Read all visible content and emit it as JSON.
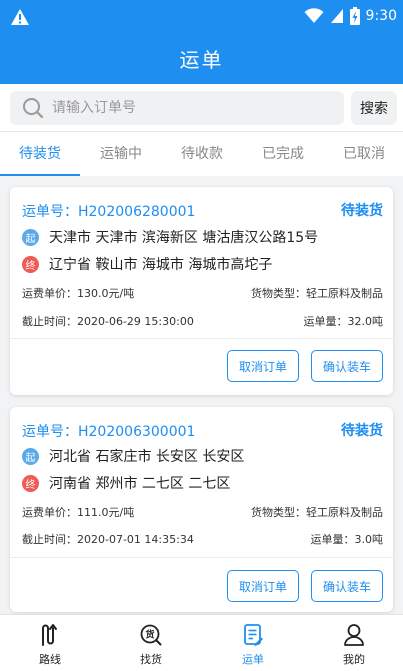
{
  "status_bar": {
    "time": "9:30"
  },
  "header": {
    "title": "运单"
  },
  "search": {
    "placeholder": "请输入订单号",
    "value": "",
    "button_label": "搜索"
  },
  "tabs": [
    {
      "label": "待装货",
      "active": true
    },
    {
      "label": "运输中"
    },
    {
      "label": "待收款"
    },
    {
      "label": "已完成"
    },
    {
      "label": "已取消"
    }
  ],
  "orders": [
    {
      "order_no": "运单号：H202006280001",
      "status": "待装货",
      "start_badge": "起",
      "from": "天津市 天津市 滨海新区 塘沽唐汉公路15号",
      "end_badge": "终",
      "to": "辽宁省 鞍山市 海城市 海城市高坨子",
      "unit_price": "运费单价：130.0元/吨",
      "cargo_type": "货物类型：轻工原料及制品",
      "deadline": "截止时间：2020-06-29 15:30:00",
      "volume": "运单量：32.0吨",
      "cancel_label": "取消订单",
      "confirm_label": "确认装车"
    },
    {
      "order_no": "运单号：H202006300001",
      "status": "待装货",
      "start_badge": "起",
      "from": "河北省 石家庄市 长安区 长安区",
      "end_badge": "终",
      "to": "河南省 郑州市 二七区 二七区",
      "unit_price": "运费单价：111.0元/吨",
      "cargo_type": "货物类型：轻工原料及制品",
      "deadline": "截止时间：2020-07-01 14:35:34",
      "volume": "运单量：3.0吨",
      "cancel_label": "取消订单",
      "confirm_label": "确认装车"
    }
  ],
  "bottom_nav": [
    {
      "label": "路线",
      "icon": "route-icon"
    },
    {
      "label": "找货",
      "icon": "find-goods-icon"
    },
    {
      "label": "运单",
      "icon": "waybill-icon",
      "active": true
    },
    {
      "label": "我的",
      "icon": "user-icon"
    }
  ],
  "colors": {
    "primary": "#1e8ef0",
    "start_badge": "#5aa9ea",
    "end_badge": "#ef5b55"
  }
}
